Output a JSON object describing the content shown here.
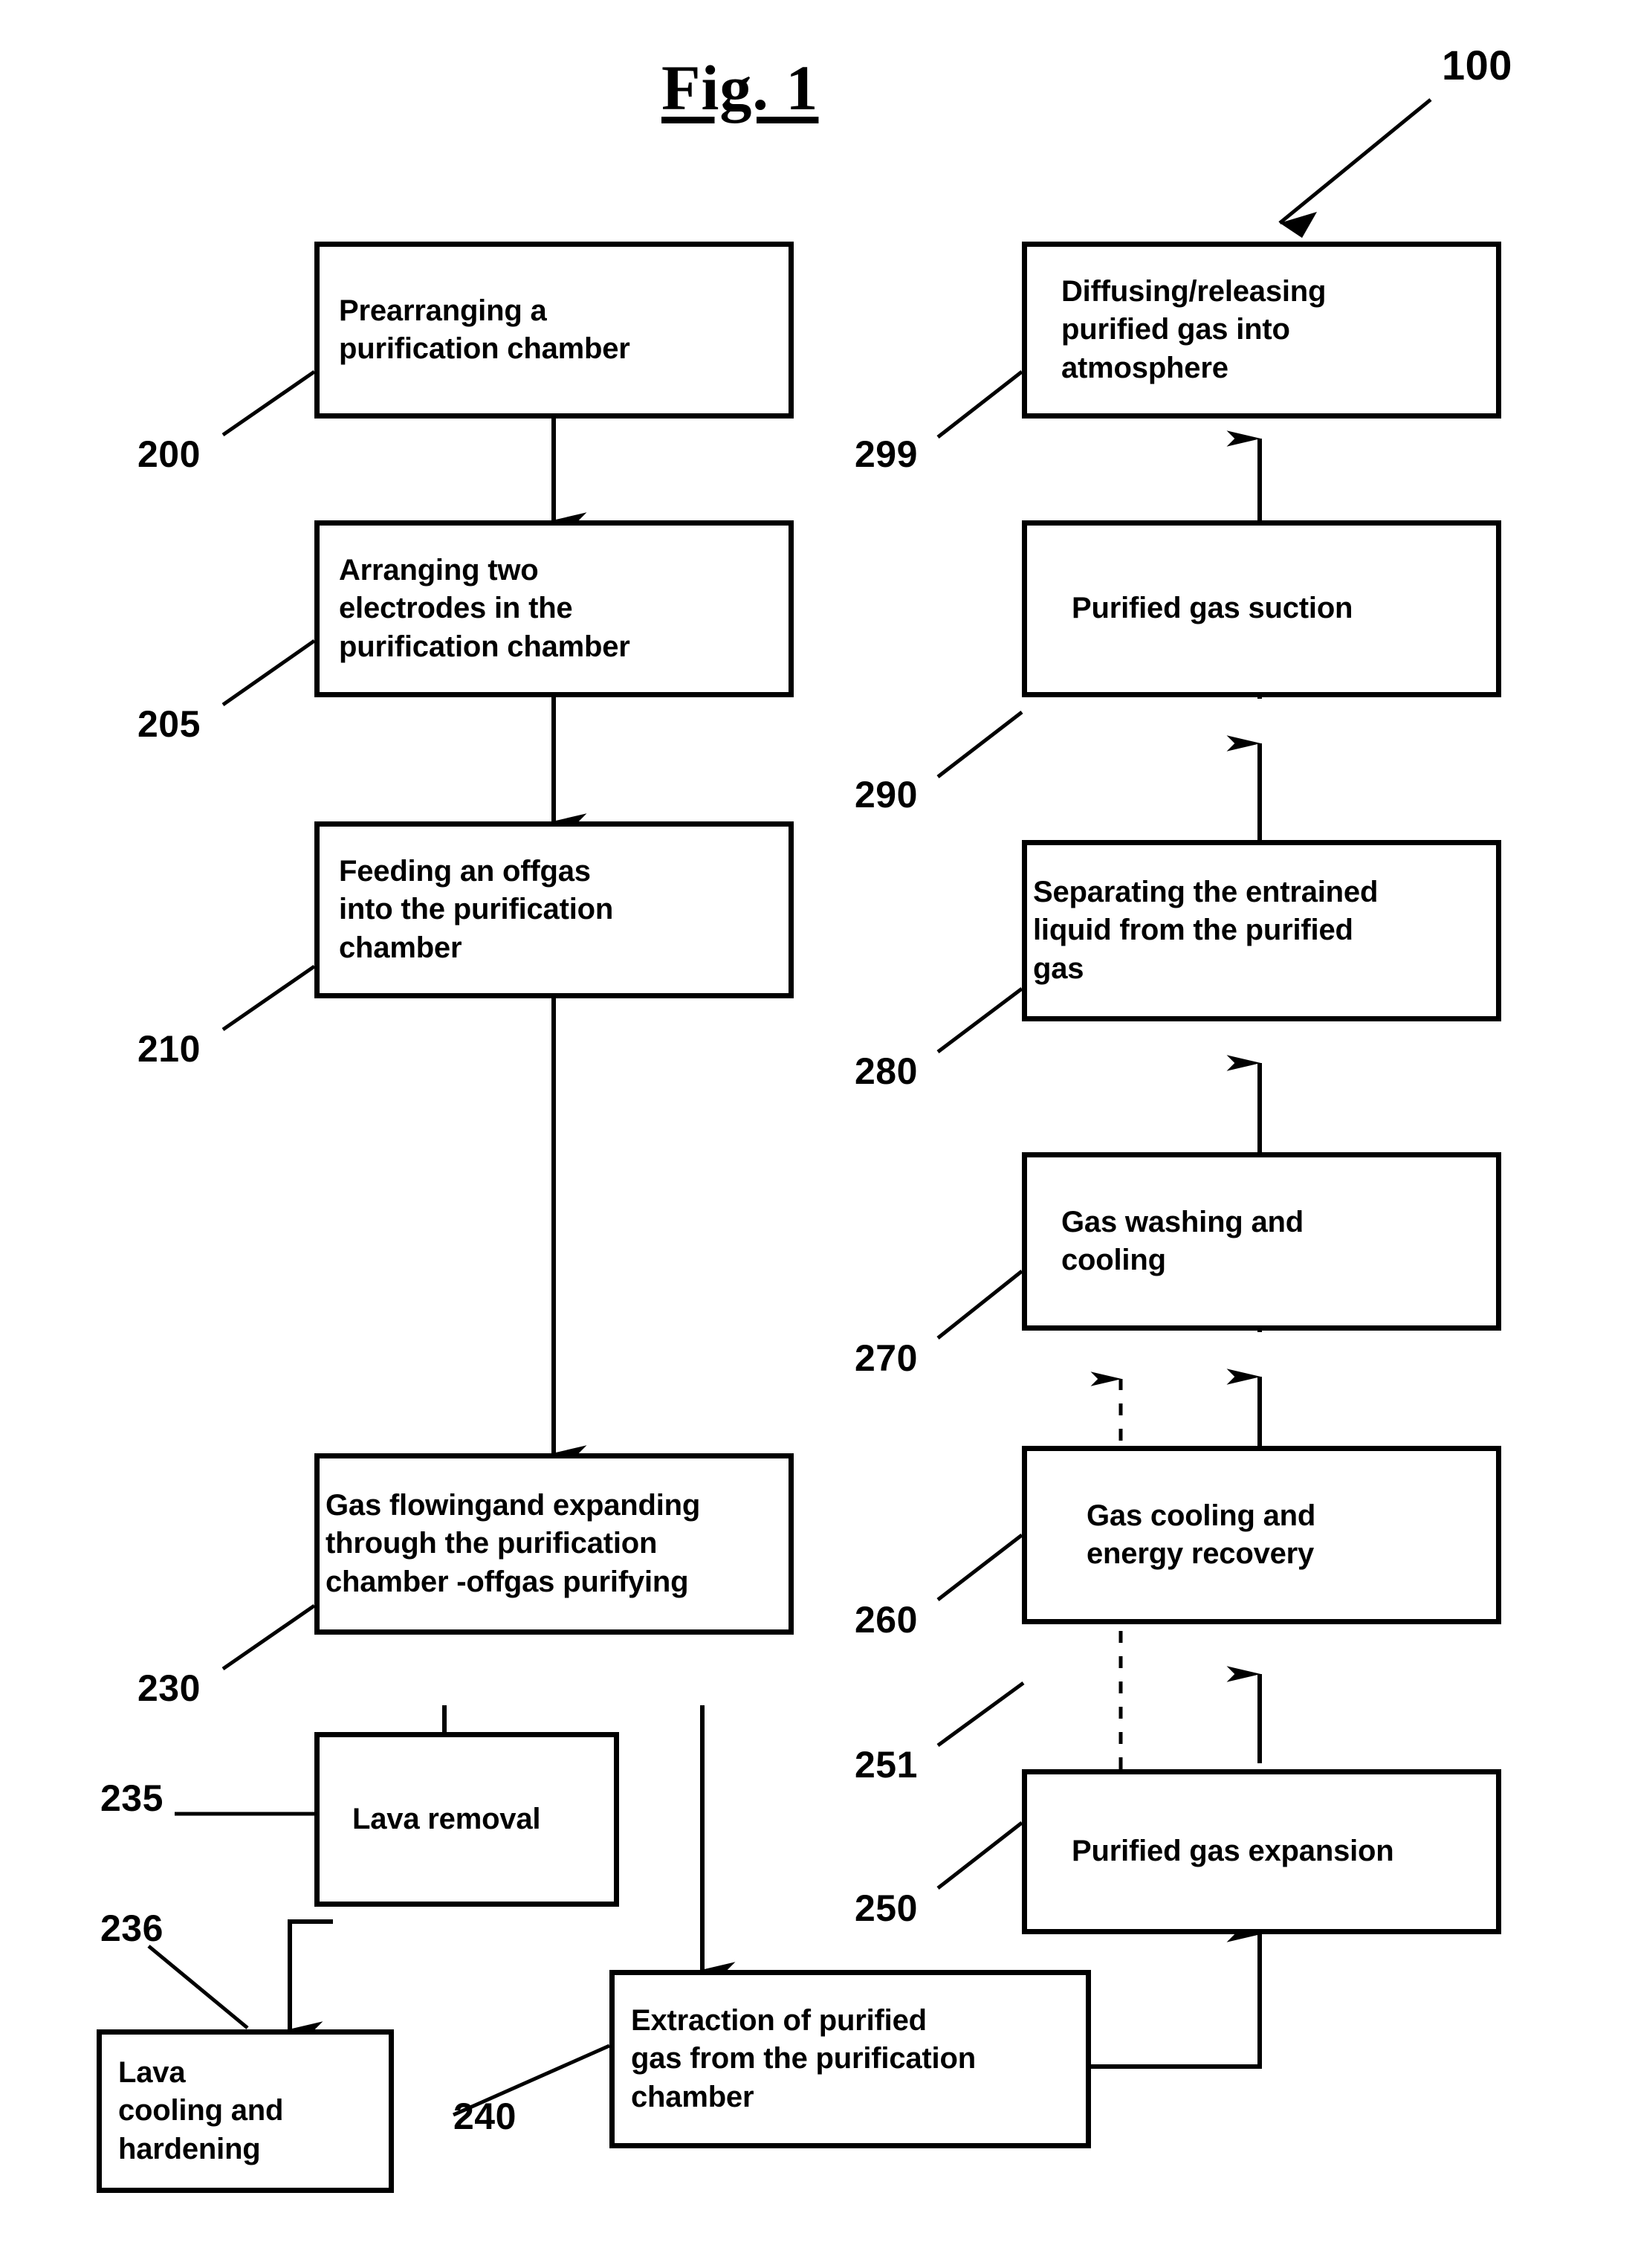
{
  "figure": {
    "title": "Fig. 1",
    "system_ref": "100"
  },
  "nodes": [
    {
      "ref": "200",
      "label": "Prearranging a\npurification chamber"
    },
    {
      "ref": "205",
      "label": "Arranging two\nelectrodes in the\npurification chamber"
    },
    {
      "ref": "210",
      "label": "Feeding an offgas\ninto the purification\nchamber"
    },
    {
      "ref": "230",
      "label": "Gas flowingand expanding\nthrough the purification\nchamber -offgas purifying"
    },
    {
      "ref": "235",
      "label": "Lava removal"
    },
    {
      "ref": "236",
      "label": "Lava\ncooling and\nhardening"
    },
    {
      "ref": "240",
      "label": "Extraction of purified\ngas from the purification\nchamber"
    },
    {
      "ref": "250",
      "label": "Purified gas expansion"
    },
    {
      "ref": "251",
      "label": ""
    },
    {
      "ref": "260",
      "label": "Gas cooling and\nenergy recovery"
    },
    {
      "ref": "270",
      "label": "Gas washing and\ncooling"
    },
    {
      "ref": "280",
      "label": "Separating the entrained\nliquid from the purified\ngas"
    },
    {
      "ref": "290",
      "label": "Purified gas suction"
    },
    {
      "ref": "299",
      "label": "Diffusing/releasing\npurified gas into\natmosphere"
    }
  ],
  "colors": {
    "ink": "#000000",
    "paper": "#ffffff"
  }
}
